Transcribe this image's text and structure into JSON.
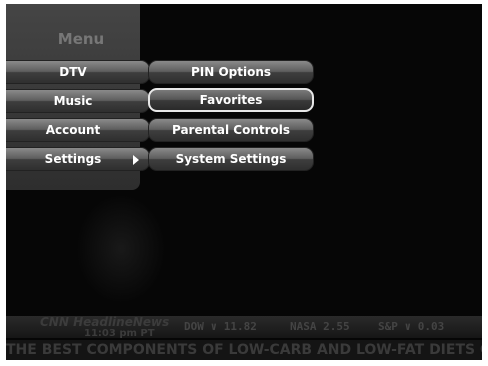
{
  "menu": {
    "title": "Menu",
    "left_items": [
      {
        "label": "DTV"
      },
      {
        "label": "Music"
      },
      {
        "label": "Account"
      },
      {
        "label": "Settings"
      }
    ],
    "right_items": [
      {
        "label": "PIN Options",
        "selected": false
      },
      {
        "label": "Favorites",
        "selected": true
      },
      {
        "label": "Parental Controls",
        "selected": false
      },
      {
        "label": "System Settings",
        "selected": false
      }
    ]
  },
  "ticker": {
    "channel_logo": "CNN HeadlineNews",
    "time": "11:03 pm PT",
    "stocks": [
      {
        "text": "DOW ∨ 11.82"
      },
      {
        "text": "NASA 2.55"
      },
      {
        "text": "S&P ∨ 0.03"
      }
    ],
    "crawl": "THE BEST COMPONENTS OF LOW-CARB AND LOW-FAT DIETS CO"
  }
}
